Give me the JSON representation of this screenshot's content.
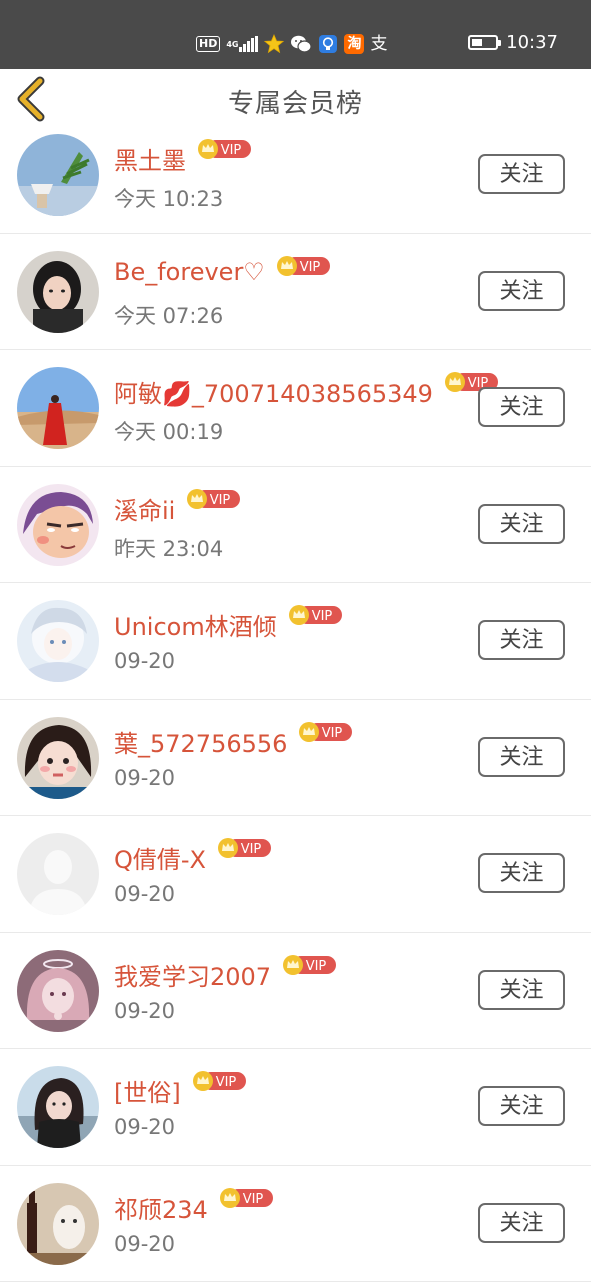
{
  "status_bar": {
    "hd": "HD",
    "network": "4G",
    "icons": [
      "star-app-icon",
      "wechat-icon",
      "bulb-app-icon",
      "taobao-icon",
      "alipay-icon"
    ],
    "taobao_glyph": "淘",
    "alipay_glyph": "支",
    "battery_percent": 45,
    "time": "10:37"
  },
  "header": {
    "title": "专属会员榜"
  },
  "vip_label": "VIP",
  "follow_label": "关注",
  "colors": {
    "name": "#d6543a",
    "vip_badge": "#e0554f",
    "crown": "#f2c12e",
    "status_bar": "#4a4a4a",
    "back_arrow": "#e6b12a"
  },
  "members": [
    {
      "name": "黑土墨",
      "time": "今天 10:23",
      "avatar": "paper-boat-plant-photo"
    },
    {
      "name": "Be_forever♡",
      "time": "今天 07:26",
      "avatar": "girl-portrait-photo"
    },
    {
      "name": "阿敏💋_700714038565349",
      "time": "今天 00:19",
      "avatar": "red-dress-desert-photo"
    },
    {
      "name": "溪命ii",
      "time": "昨天 23:04",
      "avatar": "cartoon-face-avatar"
    },
    {
      "name": "Unicom林酒倾",
      "time": "09-20",
      "avatar": "anime-white-hair-avatar"
    },
    {
      "name": "葉_572756556",
      "time": "09-20",
      "avatar": "girl-selfie-photo"
    },
    {
      "name": "Q倩倩-X",
      "time": "09-20",
      "avatar": "default-avatar"
    },
    {
      "name": "我爱学习2007",
      "time": "09-20",
      "avatar": "anime-pink-avatar"
    },
    {
      "name": "[世俗]",
      "time": "09-20",
      "avatar": "girl-scarf-photo"
    },
    {
      "name": "祁颀234",
      "time": "09-20",
      "avatar": "doll-bottle-photo"
    }
  ]
}
